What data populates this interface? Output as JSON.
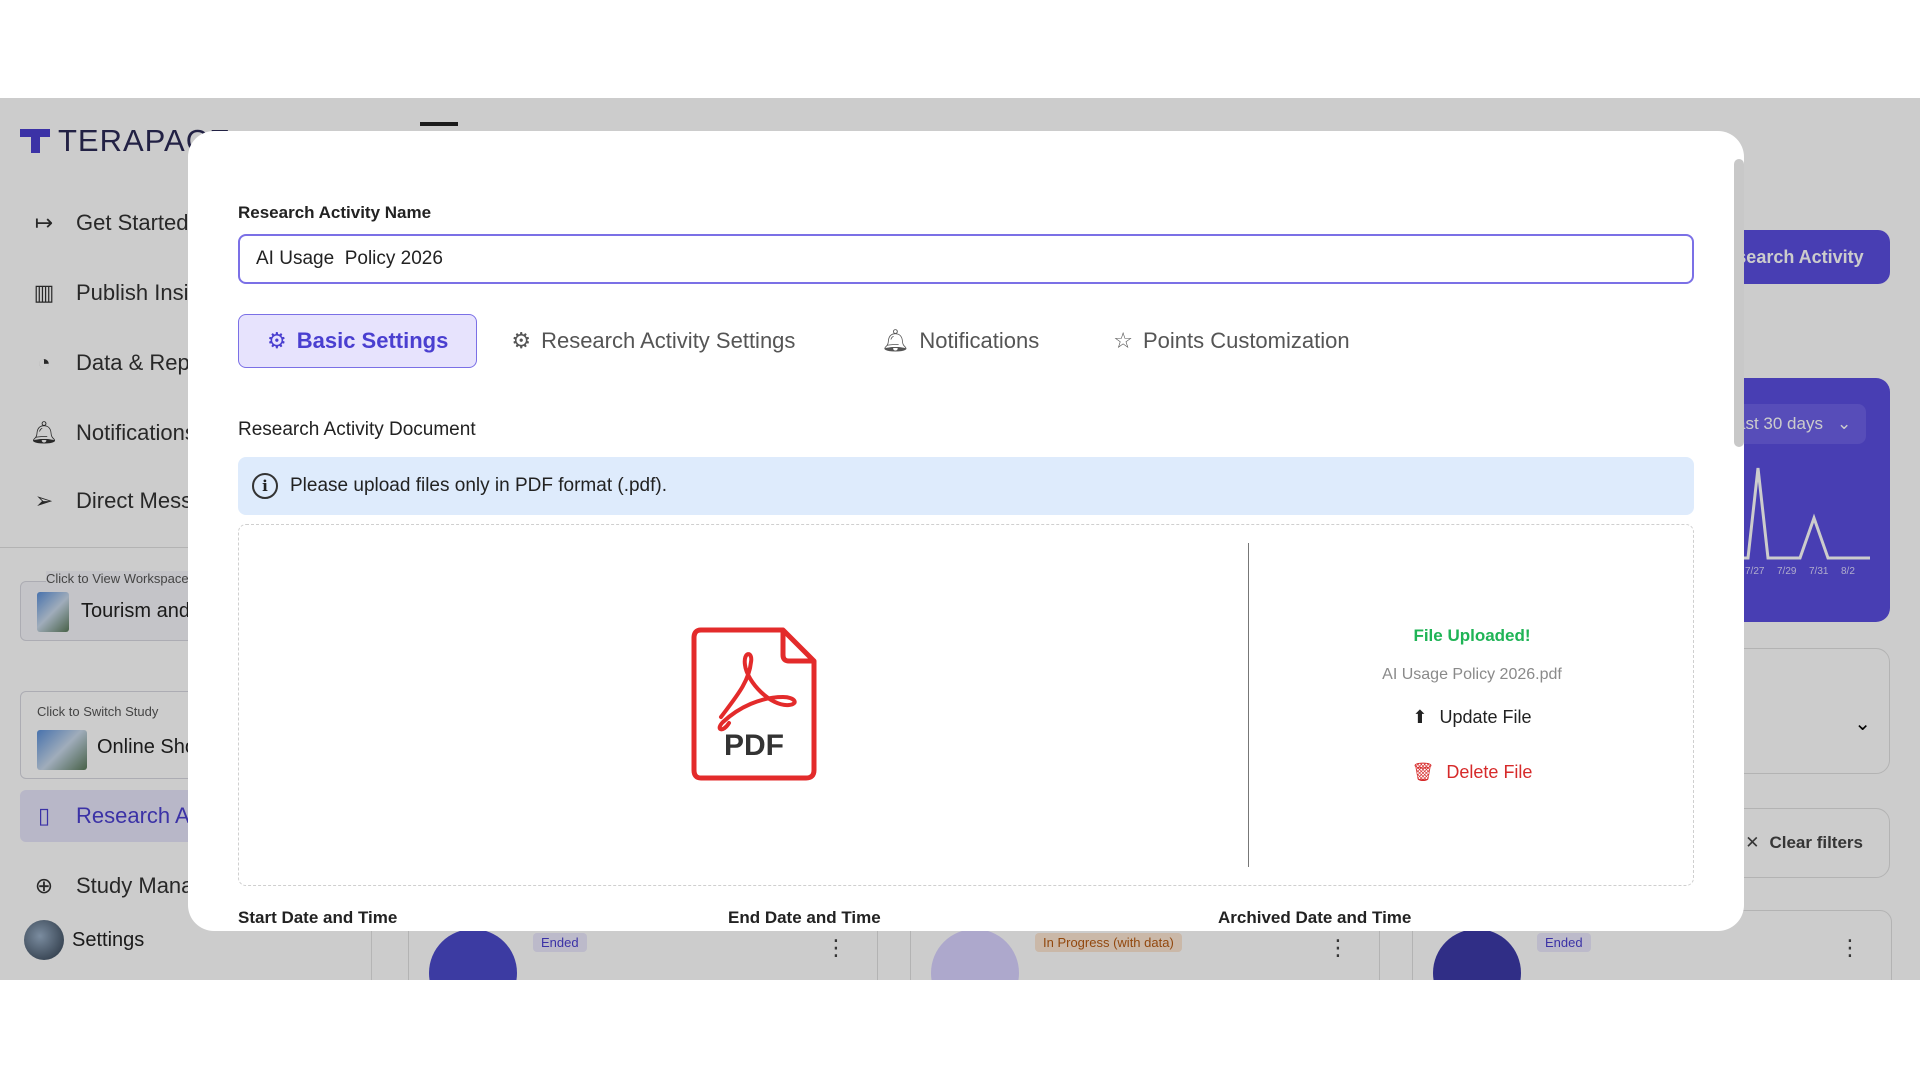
{
  "app": {
    "logo": "TERAPACE",
    "nav": [
      {
        "label": "Get Started",
        "icon": "arrow-right-bar-icon"
      },
      {
        "label": "Publish Insi",
        "icon": "books-icon"
      },
      {
        "label": "Data & Rep",
        "icon": "chart-circle-icon"
      },
      {
        "label": "Notifications",
        "icon": "bell-icon"
      },
      {
        "label": "Direct Mess",
        "icon": "send-icon"
      }
    ],
    "workspace": {
      "caption": "Click to View Workspace",
      "name": "Tourism and"
    },
    "study": {
      "caption": "Click to Switch Study",
      "name": "Online Sho"
    },
    "nav_lower": [
      {
        "label": "Research A",
        "icon": "map-icon"
      },
      {
        "label": "Study Mana",
        "icon": "globe-icon"
      }
    ],
    "settings_label": "Settings",
    "right_button": "esearch Activity",
    "range_label": "ast 30 days",
    "spark_ticks": [
      "7/27",
      "7/29",
      "7/31",
      "8/2"
    ],
    "clear_filters": "Clear filters",
    "cards": [
      {
        "badge": "Ended"
      },
      {
        "badge": "In Progress (with data)"
      },
      {
        "badge": "Ended"
      }
    ]
  },
  "modal": {
    "name_label": "Research Activity Name",
    "name_value": "AI Usage  Policy 2026",
    "tabs": [
      {
        "label": "Basic Settings",
        "icon": "gear-icon",
        "active": true
      },
      {
        "label": "Research Activity Settings",
        "icon": "gear-icon",
        "active": false
      },
      {
        "label": "Notifications",
        "icon": "bell-icon",
        "active": false
      },
      {
        "label": "Points Customization",
        "icon": "star-icon",
        "active": false
      }
    ],
    "document_title": "Research Activity Document",
    "info_text": "Please upload files only in PDF format (.pdf).",
    "pdf_label": "PDF",
    "upload_status": "File Uploaded!",
    "file_name": "AI Usage Policy 2026.pdf",
    "update_label": "Update File",
    "delete_label": "Delete File",
    "date_labels": [
      "Start Date and Time",
      "End Date and Time",
      "Archived Date and Time"
    ]
  },
  "colors": {
    "accent": "#5b4ee0",
    "tab_active_bg": "#e7e3fd",
    "info_bg": "#deebfc",
    "success": "#1fb456",
    "danger": "#d62a2a",
    "pdf_red": "#e32b2b"
  }
}
